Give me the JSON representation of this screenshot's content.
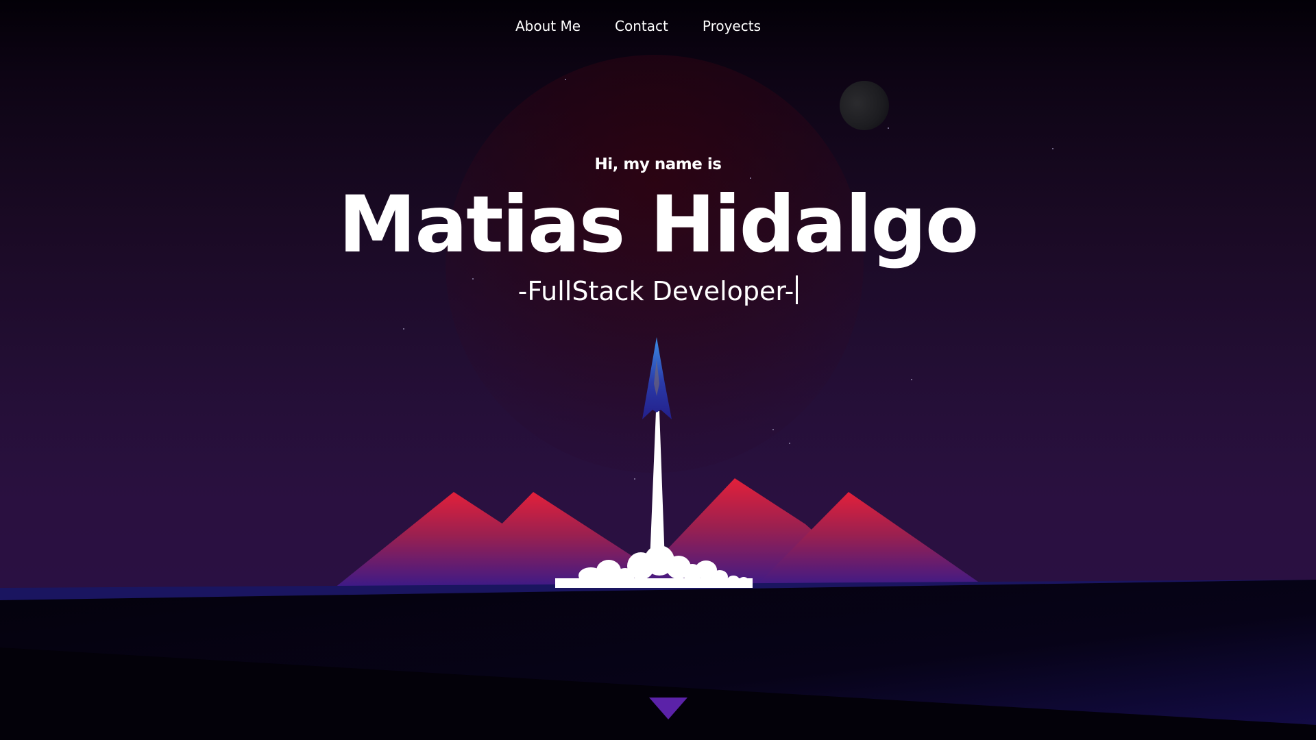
{
  "nav": {
    "items": [
      {
        "label": "About Me"
      },
      {
        "label": "Contact"
      },
      {
        "label": "Proyects"
      }
    ]
  },
  "hero": {
    "greeting": "Hi, my name is",
    "name": "Matias Hidalgo",
    "role": "-FullStack Developer-"
  },
  "icons": {
    "scroll_down": "triangle-down-icon",
    "rocket": "rocket-icon"
  },
  "colors": {
    "mountain_top": "#e3203a",
    "mountain_bottom": "#3b1a88",
    "rocket_body": "#2e2c9a",
    "scroll_arrow": "#5b22a8",
    "ground": "#040210",
    "sky_top": "#030007",
    "sky_bottom": "#2b1145"
  }
}
